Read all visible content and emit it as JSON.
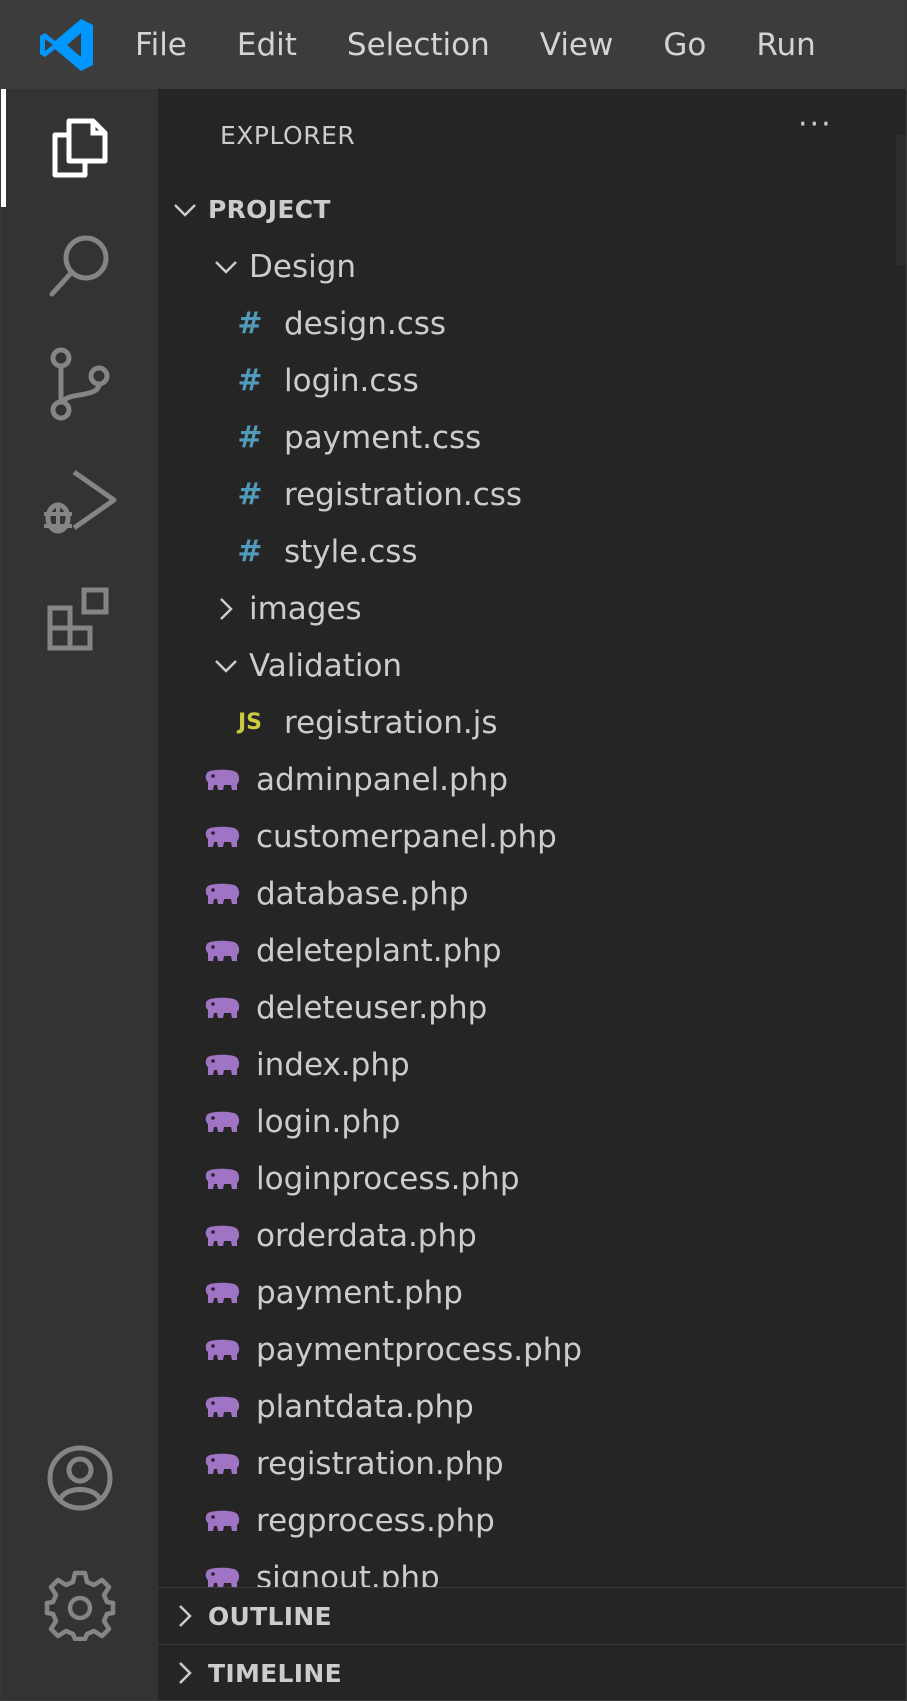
{
  "menu": [
    "File",
    "Edit",
    "Selection",
    "View",
    "Go",
    "Run"
  ],
  "activity": [
    {
      "name": "explorer-icon",
      "active": true
    },
    {
      "name": "search-icon"
    },
    {
      "name": "source-control-icon"
    },
    {
      "name": "run-debug-icon"
    },
    {
      "name": "extensions-icon"
    },
    {
      "name": "accounts-icon"
    },
    {
      "name": "manage-gear-icon"
    }
  ],
  "sidebar": {
    "title": "EXPLORER",
    "more": "···",
    "project": "PROJECT",
    "folders": {
      "design": "Design",
      "images": "images",
      "validation": "Validation"
    },
    "design_files": [
      "design.css",
      "login.css",
      "payment.css",
      "registration.css",
      "style.css"
    ],
    "validation_files": [
      "registration.js"
    ],
    "js_badge": "JS",
    "css_badge": "#",
    "php_files": [
      "adminpanel.php",
      "customerpanel.php",
      "database.php",
      "deleteplant.php",
      "deleteuser.php",
      "index.php",
      "login.php",
      "loginprocess.php",
      "orderdata.php",
      "payment.php",
      "paymentprocess.php",
      "plantdata.php",
      "registration.php",
      "regprocess.php",
      "signout.php"
    ],
    "outline": "OUTLINE",
    "timeline": "TIMELINE"
  },
  "colors": {
    "menubar": "#3c3c3c",
    "activitybar": "#333333",
    "sidebar": "#252526",
    "css_icon": "#519aba",
    "js_icon": "#cbcb41",
    "php_icon": "#a074c4",
    "vscode_blue": "#0098ff"
  }
}
